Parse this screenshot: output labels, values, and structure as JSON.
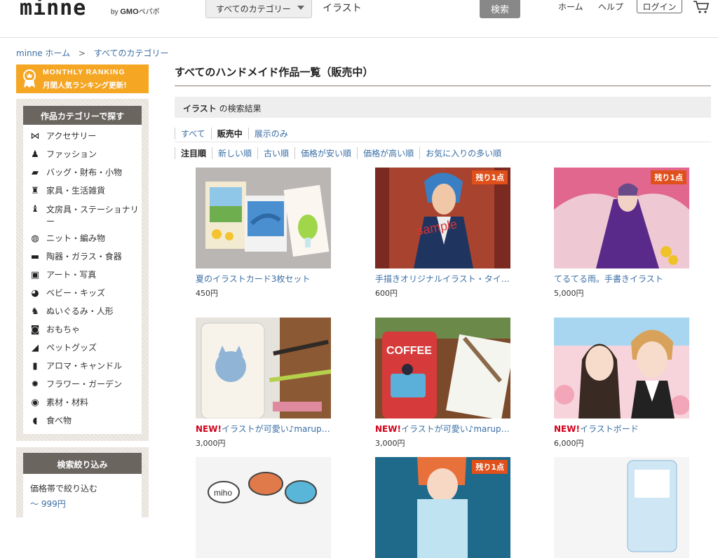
{
  "header": {
    "logo": "minne",
    "byline_prefix": "by",
    "byline_brand": "GMO",
    "byline_suffix": "ペパボ",
    "category_select": "すべてのカテゴリー",
    "search_value": "イラスト",
    "search_button": "検索",
    "nav_home": "ホーム",
    "nav_help": "ヘルプ",
    "login": "ログイン",
    "cart_icon": "cart-icon"
  },
  "breadcrumb": {
    "home": "minne ホーム",
    "separator": ">",
    "current": "すべてのカテゴリー"
  },
  "ranking_banner": {
    "line1": "MONTHLY RANKING",
    "line2": "月間人気ランキング更新!",
    "color": "#f5a623"
  },
  "sidebar": {
    "category_title": "作品カテゴリーで探す",
    "categories": [
      {
        "label": "アクセサリー",
        "icon": "bowtie-icon"
      },
      {
        "label": "ファッション",
        "icon": "dress-icon"
      },
      {
        "label": "バッグ・財布・小物",
        "icon": "bag-icon"
      },
      {
        "label": "家具・生活雑貨",
        "icon": "chair-icon"
      },
      {
        "label": "文房具・ステーショナリー",
        "icon": "ink-bottle-icon"
      },
      {
        "label": "ニット・編み物",
        "icon": "yarn-icon"
      },
      {
        "label": "陶器・ガラス・食器",
        "icon": "mug-icon"
      },
      {
        "label": "アート・写真",
        "icon": "frame-icon"
      },
      {
        "label": "ベビー・キッズ",
        "icon": "duck-icon"
      },
      {
        "label": "ぬいぐるみ・人形",
        "icon": "bear-icon"
      },
      {
        "label": "おもちゃ",
        "icon": "robot-icon"
      },
      {
        "label": "ペットグッズ",
        "icon": "cat-icon"
      },
      {
        "label": "アロマ・キャンドル",
        "icon": "candle-icon"
      },
      {
        "label": "フラワー・ガーデン",
        "icon": "flower-icon"
      },
      {
        "label": "素材・材料",
        "icon": "button-icon"
      },
      {
        "label": "食べ物",
        "icon": "bread-icon"
      }
    ],
    "filter_title": "検索絞り込み",
    "price_label": "価格帯で絞り込む",
    "price_range": "〜 999円"
  },
  "main": {
    "page_title": "すべてのハンドメイド作品一覧（販売中）",
    "result_keyword": "イラスト",
    "result_suffix": "の検索結果",
    "filter_tabs": [
      {
        "label": "すべて",
        "active": false
      },
      {
        "label": "販売中",
        "active": true
      },
      {
        "label": "展示のみ",
        "active": false
      }
    ],
    "sort_tabs": [
      {
        "label": "注目順",
        "active": true
      },
      {
        "label": "新しい順",
        "active": false
      },
      {
        "label": "古い順",
        "active": false
      },
      {
        "label": "価格が安い順",
        "active": false
      },
      {
        "label": "価格が高い順",
        "active": false
      },
      {
        "label": "お気に入りの多い順",
        "active": false
      }
    ],
    "items": [
      {
        "new": "",
        "title": "夏のイラストカード3枚セット",
        "price": "450円",
        "badge": ""
      },
      {
        "new": "",
        "title": "手描きオリジナルイラスト・タイ…",
        "price": "600円",
        "badge": "残り1点"
      },
      {
        "new": "",
        "title": "てるてる雨。手書きイラスト",
        "price": "5,000円",
        "badge": "残り1点"
      },
      {
        "new": "NEW!",
        "title": "イラストが可愛い♪marupo…",
        "price": "3,000円",
        "badge": ""
      },
      {
        "new": "NEW!",
        "title": "イラストが可愛い♪marupo…",
        "price": "3,000円",
        "badge": ""
      },
      {
        "new": "NEW!",
        "title": "イラストボード",
        "price": "6,000円",
        "badge": ""
      },
      {
        "new": "",
        "title": "",
        "price": "",
        "badge": ""
      },
      {
        "new": "",
        "title": "",
        "price": "",
        "badge": "残り1点"
      },
      {
        "new": "",
        "title": "",
        "price": "",
        "badge": ""
      }
    ]
  }
}
